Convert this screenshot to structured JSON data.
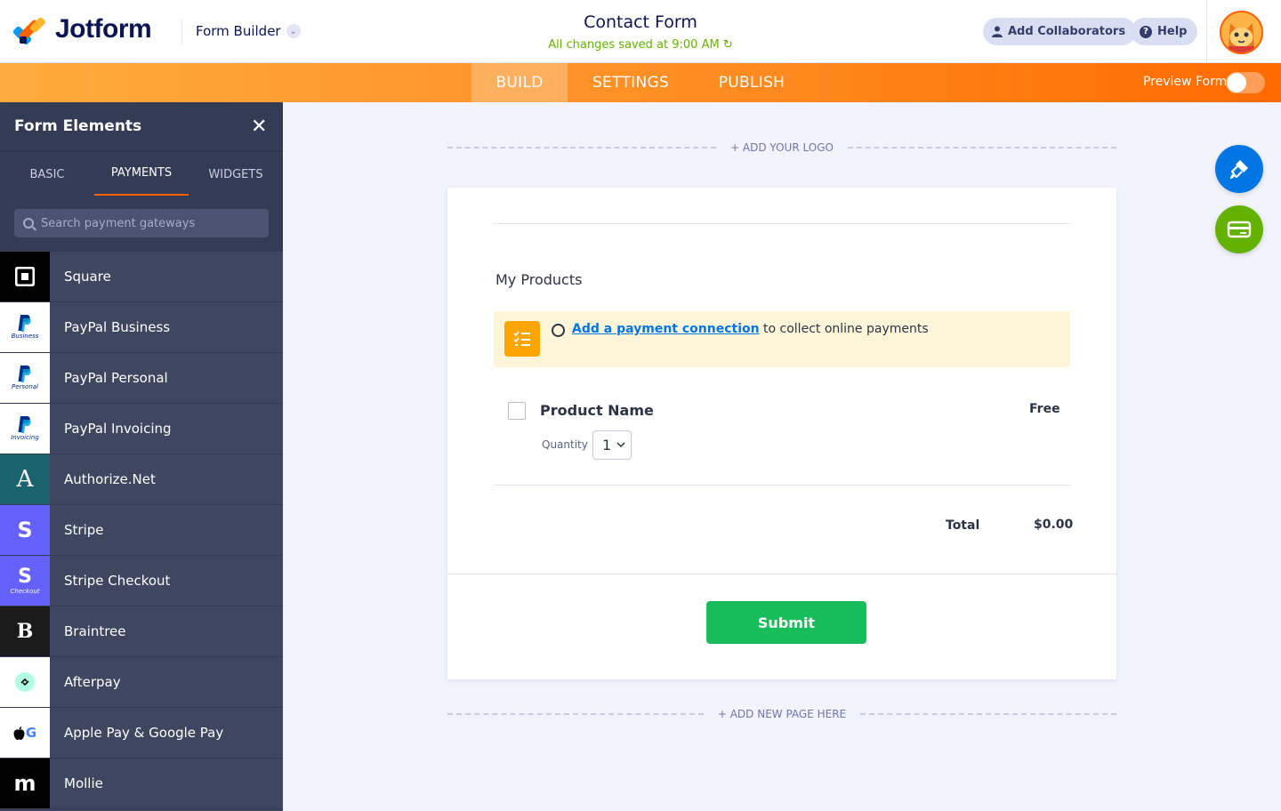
{
  "header": {
    "logo_text": "Jotform",
    "builder_label": "Form Builder",
    "form_title": "Contact Form",
    "saved_status": "All changes saved at 9:00 AM",
    "add_collaborators": "Add Collaborators",
    "help": "Help"
  },
  "nav": {
    "tabs": [
      {
        "label": "BUILD",
        "active": true
      },
      {
        "label": "SETTINGS",
        "active": false
      },
      {
        "label": "PUBLISH",
        "active": false
      }
    ],
    "preview_label": "Preview Form",
    "preview_on": false
  },
  "sidebar": {
    "title": "Form Elements",
    "tabs": [
      {
        "label": "BASIC",
        "active": false
      },
      {
        "label": "PAYMENTS",
        "active": true
      },
      {
        "label": "WIDGETS",
        "active": false
      }
    ],
    "search_placeholder": "Search payment gateways",
    "gateways": [
      {
        "label": "Square",
        "icon": "square-icon"
      },
      {
        "label": "PayPal Business",
        "icon": "paypal-icon",
        "sub": "Business"
      },
      {
        "label": "PayPal Personal",
        "icon": "paypal-icon",
        "sub": "Personal"
      },
      {
        "label": "PayPal Invoicing",
        "icon": "paypal-icon",
        "sub": "Invoicing"
      },
      {
        "label": "Authorize.Net",
        "icon": "authorize-net-icon"
      },
      {
        "label": "Stripe",
        "icon": "stripe-icon"
      },
      {
        "label": "Stripe Checkout",
        "icon": "stripe-icon",
        "sub": "Checkout"
      },
      {
        "label": "Braintree",
        "icon": "braintree-icon"
      },
      {
        "label": "Afterpay",
        "icon": "afterpay-icon"
      },
      {
        "label": "Apple Pay & Google Pay",
        "icon": "apple-google-pay-icon"
      },
      {
        "label": "Mollie",
        "icon": "mollie-icon"
      }
    ]
  },
  "canvas": {
    "add_logo": "+ ADD YOUR LOGO",
    "add_page": "+ ADD NEW PAGE HERE",
    "section_title": "My Products",
    "notice_link": "Add a payment connection",
    "notice_rest": " to collect online payments",
    "product_name": "Product Name",
    "product_price": "Free",
    "quantity_label": "Quantity",
    "quantity_value": "1",
    "total_label": "Total",
    "total_value": "$0.00",
    "submit_label": "Submit"
  },
  "colors": {
    "brand_orange": "#ff6100",
    "sidebar_bg": "#3e4660",
    "submit_green": "#18bd5b",
    "fab_blue": "#0075e3",
    "fab_green": "#64b200"
  }
}
